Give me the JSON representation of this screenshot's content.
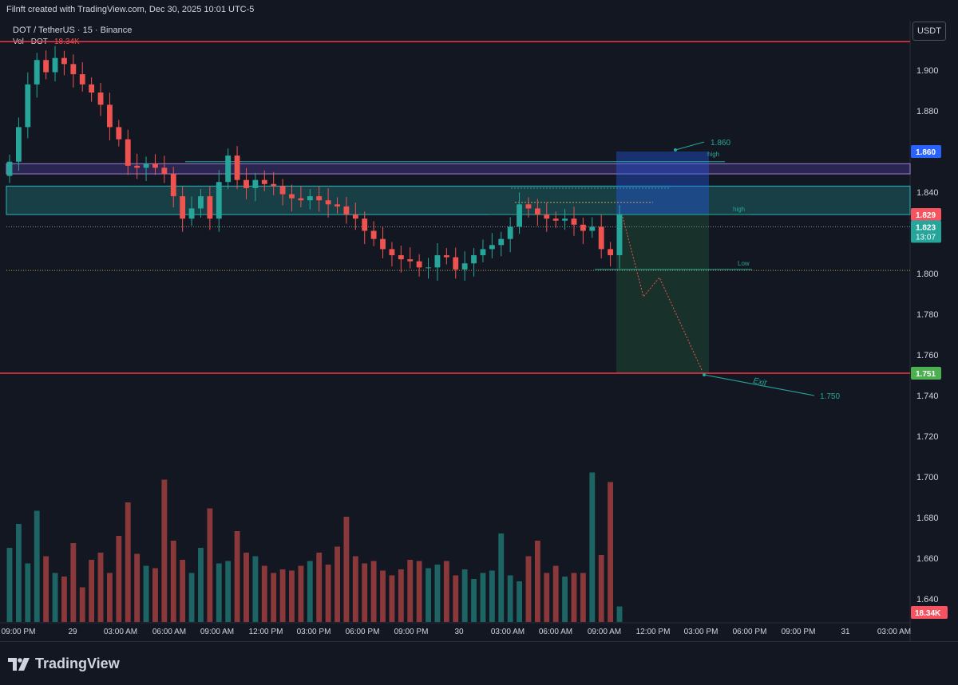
{
  "header": {
    "credit": "Filnft created with TradingView.com, Dec 30, 2025 10:01 UTC-5"
  },
  "symbol": {
    "title": "DOT / TetherUS · 15 · Binance",
    "vol_label": "Vol · DOT",
    "vol_value": "18.34K"
  },
  "currency_button": "USDT",
  "footer": {
    "brand": "TradingView"
  },
  "colors": {
    "up": "#26a69a",
    "down": "#ef5350",
    "background": "#131722",
    "level": "#f23645"
  },
  "chart_data": {
    "type": "candlestick",
    "title": "DOT / TetherUS · 15 · Binance",
    "ylim": [
      1.625,
      1.928
    ],
    "y_ticks": [
      "1.900",
      "1.880",
      "1.860",
      "1.840",
      "1.820",
      "1.800",
      "1.780",
      "1.760",
      "1.740",
      "1.720",
      "1.700",
      "1.680",
      "1.660",
      "1.640"
    ],
    "x_ticks": [
      "09:00 PM",
      "29",
      "03:00 AM",
      "06:00 AM",
      "09:00 AM",
      "12:00 PM",
      "03:00 PM",
      "06:00 PM",
      "09:00 PM",
      "30",
      "03:00 AM",
      "06:00 AM",
      "09:00 AM",
      "12:00 PM",
      "03:00 PM",
      "06:00 PM",
      "09:00 PM",
      "31",
      "03:00 AM"
    ],
    "price_close_series": [
      1.855,
      1.872,
      1.893,
      1.905,
      1.899,
      1.906,
      1.903,
      1.898,
      1.893,
      1.889,
      1.883,
      1.872,
      1.866,
      1.853,
      1.852,
      1.854,
      1.852,
      1.849,
      1.838,
      1.827,
      1.832,
      1.838,
      1.827,
      1.845,
      1.858,
      1.846,
      1.842,
      1.846,
      1.844,
      1.843,
      1.839,
      1.837,
      1.836,
      1.838,
      1.836,
      1.834,
      1.833,
      1.829,
      1.827,
      1.821,
      1.817,
      1.812,
      1.809,
      1.807,
      1.806,
      1.803,
      1.803,
      1.809,
      1.808,
      1.802,
      1.805,
      1.809,
      1.812,
      1.814,
      1.817,
      1.823,
      1.834,
      1.832,
      1.829,
      1.827,
      1.826,
      1.827,
      1.824,
      1.821,
      1.823,
      1.812,
      1.809,
      1.829
    ],
    "volume_series": [
      0.62,
      0.82,
      0.49,
      0.93,
      0.55,
      0.41,
      0.38,
      0.66,
      0.29,
      0.52,
      0.58,
      0.41,
      0.72,
      1.0,
      0.57,
      0.47,
      0.45,
      1.19,
      0.68,
      0.52,
      0.41,
      0.62,
      0.95,
      0.49,
      0.51,
      0.76,
      0.58,
      0.55,
      0.47,
      0.41,
      0.44,
      0.43,
      0.47,
      0.51,
      0.58,
      0.48,
      0.63,
      0.88,
      0.55,
      0.49,
      0.51,
      0.43,
      0.39,
      0.44,
      0.52,
      0.51,
      0.45,
      0.48,
      0.51,
      0.39,
      0.44,
      0.36,
      0.41,
      0.43,
      0.74,
      0.39,
      0.34,
      0.55,
      0.68,
      0.41,
      0.47,
      0.38,
      0.41,
      0.41,
      1.25,
      0.56,
      1.17,
      0.13
    ],
    "current_price": "1.823",
    "countdown": "13:07",
    "last_volume": "18.34K",
    "levels": [
      {
        "label": "",
        "value": 1.914
      },
      {
        "label": "",
        "value": 1.751
      }
    ],
    "price_badges": [
      "1.860",
      "1.829",
      "1.823",
      "1.751"
    ],
    "zones": [
      {
        "name": "purple-zone",
        "from": 1.849,
        "to": 1.854
      },
      {
        "name": "teal-zone",
        "from": 1.829,
        "to": 1.843
      }
    ],
    "annotations": [
      {
        "text": "1.860",
        "kind": "target-label"
      },
      {
        "text": "high",
        "kind": "level-label"
      },
      {
        "text": "high",
        "kind": "level-label"
      },
      {
        "text": "Low",
        "kind": "level-label"
      },
      {
        "text": "Exit",
        "kind": "path-label"
      },
      {
        "text": "1.750",
        "kind": "target-label"
      }
    ],
    "position": {
      "type": "short",
      "entry": 1.829,
      "stop": 1.86,
      "target": 1.751
    }
  }
}
